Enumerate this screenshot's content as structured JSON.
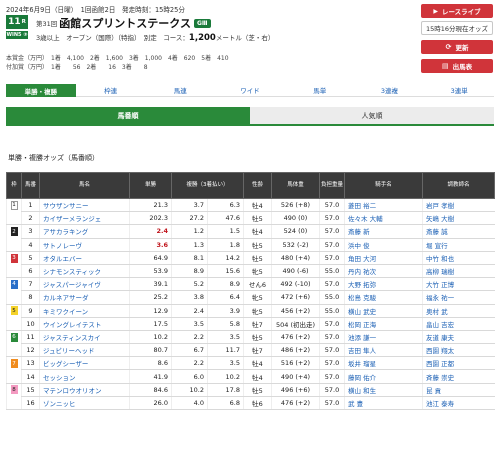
{
  "header": {
    "date_line": "2024年6月9日（日曜）　1回函館2日　発走時刻：15時25分",
    "race_number": "11",
    "race_number_unit": "R",
    "race_label": "WIN5 ③",
    "race_count": "第31回",
    "race_name": "函館スプリントステークス",
    "grade": "GⅢ",
    "conditions_prefix": "3歳以上　オープン（国際）（特指）　別定　コース：",
    "distance": "1,200",
    "conditions_suffix": "メートル（芝・右）",
    "prize_line_1": "本賞金（万円）　1着　4,100　2着　1,600　3着　1,000　4着　620　5着　410",
    "prize_line_2": "付加賞（万円）　1着　　56　2着　　16　3着　　8"
  },
  "side_buttons": {
    "live_label": "レースライブ",
    "live_icon": "play-icon",
    "now_label": "15時16分現在オッズ",
    "refresh_label": "更新",
    "entries_label": "出馬表"
  },
  "bet_tabs": [
    "単勝・複勝",
    "枠連",
    "馬連",
    "ワイド",
    "馬単",
    "3連複",
    "3連単"
  ],
  "sort_tabs": [
    "馬番順",
    "人気順"
  ],
  "section_title": "単勝・複勝オッズ（馬番順）",
  "table": {
    "headers": [
      "枠",
      "馬番",
      "馬名",
      "単勝",
      "複勝（3着払い）",
      "性齢",
      "馬体重",
      "負担重量",
      "騎手名",
      "調教師名"
    ],
    "rows": [
      {
        "waku": "1",
        "num": "1",
        "name": "サウザンサニー",
        "win": "21.3",
        "pmin": "3.7",
        "pmax": "6.3",
        "sex": "牡4",
        "weight": "526 (+8)",
        "load": "57.0",
        "jockey": "菱田 裕二",
        "trainer": "岩戸 孝樹"
      },
      {
        "waku": "",
        "num": "2",
        "name": "カイザーメランジェ",
        "win": "202.3",
        "pmin": "27.2",
        "pmax": "47.6",
        "sex": "牡5",
        "weight": "490 (0)",
        "load": "57.0",
        "jockey": "佐々木 大輔",
        "trainer": "矢嶋 大樹"
      },
      {
        "waku": "2",
        "num": "3",
        "name": "アサカラキング",
        "win": "2.4",
        "pmin": "1.2",
        "pmax": "1.5",
        "sex": "牡4",
        "weight": "524 (0)",
        "load": "57.0",
        "jockey": "斎藤 新",
        "trainer": "斎藤 誠"
      },
      {
        "waku": "",
        "num": "4",
        "name": "サトノレーヴ",
        "win": "3.6",
        "pmin": "1.3",
        "pmax": "1.8",
        "sex": "牡5",
        "weight": "532 (-2)",
        "load": "57.0",
        "jockey": "浜中 俊",
        "trainer": "堀 宣行"
      },
      {
        "waku": "3",
        "num": "5",
        "name": "オタルエバー",
        "win": "64.9",
        "pmin": "8.1",
        "pmax": "14.2",
        "sex": "牡5",
        "weight": "480 (+4)",
        "load": "57.0",
        "jockey": "角田 大河",
        "trainer": "中竹 和也"
      },
      {
        "waku": "",
        "num": "6",
        "name": "シナモンスティック",
        "win": "53.9",
        "pmin": "8.9",
        "pmax": "15.6",
        "sex": "牝5",
        "weight": "490 (-6)",
        "load": "55.0",
        "jockey": "丹内 祐次",
        "trainer": "高柳 瑞樹"
      },
      {
        "waku": "4",
        "num": "7",
        "name": "ジャスパージャイヴ",
        "win": "39.1",
        "pmin": "5.2",
        "pmax": "8.9",
        "sex": "せん6",
        "weight": "492 (-10)",
        "load": "57.0",
        "jockey": "大野 拓弥",
        "trainer": "大竹 正博"
      },
      {
        "waku": "",
        "num": "8",
        "name": "カルネアサーダ",
        "win": "25.2",
        "pmin": "3.8",
        "pmax": "6.4",
        "sex": "牝5",
        "weight": "472 (+6)",
        "load": "55.0",
        "jockey": "松島 克駿",
        "trainer": "福永 祐一"
      },
      {
        "waku": "5",
        "num": "9",
        "name": "キミワクイーン",
        "win": "12.9",
        "pmin": "2.4",
        "pmax": "3.9",
        "sex": "牝5",
        "weight": "456 (+2)",
        "load": "55.0",
        "jockey": "横山 武史",
        "trainer": "奥村 武"
      },
      {
        "waku": "",
        "num": "10",
        "name": "ウイングレイテスト",
        "win": "17.5",
        "pmin": "3.5",
        "pmax": "5.8",
        "sex": "牡7",
        "weight": "504 (初出走)",
        "load": "57.0",
        "jockey": "松岡 正海",
        "trainer": "畠山 吉宏"
      },
      {
        "waku": "6",
        "num": "11",
        "name": "ジャスティンスカイ",
        "win": "10.2",
        "pmin": "2.2",
        "pmax": "3.5",
        "sex": "牡5",
        "weight": "476 (+2)",
        "load": "57.0",
        "jockey": "池添 謙一",
        "trainer": "友道 康夫"
      },
      {
        "waku": "",
        "num": "12",
        "name": "ジュビリーヘッド",
        "win": "80.7",
        "pmin": "6.7",
        "pmax": "11.7",
        "sex": "牡7",
        "weight": "486 (+2)",
        "load": "57.0",
        "jockey": "吉田 隼人",
        "trainer": "西園 翔太"
      },
      {
        "waku": "7",
        "num": "13",
        "name": "ビッグシーザー",
        "win": "8.6",
        "pmin": "2.2",
        "pmax": "3.5",
        "sex": "牡4",
        "weight": "516 (+2)",
        "load": "57.0",
        "jockey": "坂井 瑠星",
        "trainer": "西園 正都"
      },
      {
        "waku": "",
        "num": "14",
        "name": "セッション",
        "win": "41.9",
        "pmin": "6.0",
        "pmax": "10.2",
        "sex": "牡4",
        "weight": "490 (+4)",
        "load": "57.0",
        "jockey": "藤岡 佑介",
        "trainer": "斉藤 崇史"
      },
      {
        "waku": "8",
        "num": "15",
        "name": "マテンロウオリオン",
        "win": "84.6",
        "pmin": "10.2",
        "pmax": "17.8",
        "sex": "牡5",
        "weight": "496 (+6)",
        "load": "57.0",
        "jockey": "横山 和生",
        "trainer": "昆 貢"
      },
      {
        "waku": "",
        "num": "16",
        "name": "ゾンニッヒ",
        "win": "26.0",
        "pmin": "4.0",
        "pmax": "6.8",
        "sex": "牡6",
        "weight": "476 (+2)",
        "load": "57.0",
        "jockey": "武 豊",
        "trainer": "池江 泰寿"
      }
    ]
  },
  "colors": {
    "accent_green": "#2a8a3a",
    "button_red": "#d0343a",
    "favorite_red": "#c0161d",
    "link_blue": "#1a5fb4"
  }
}
